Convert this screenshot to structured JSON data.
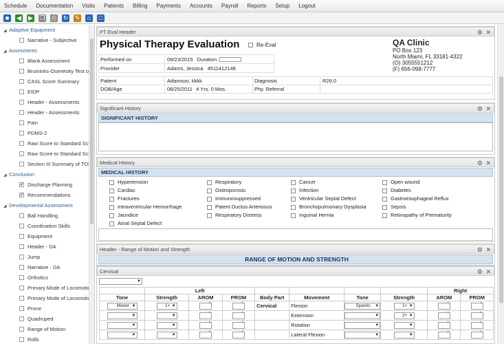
{
  "menu": [
    "Schedule",
    "Documentation",
    "Visits",
    "Patients",
    "Billing",
    "Payments",
    "Accounts",
    "Payroll",
    "Reports",
    "Setup",
    "Logout"
  ],
  "toolbar_icons": [
    "save-icon",
    "back-arrow-icon",
    "forward-arrow-icon",
    "copy-icon",
    "print-icon",
    "refresh-icon",
    "edit-icon",
    "home-icon",
    "export-icon"
  ],
  "sidebar": {
    "groups": [
      {
        "label": "Adaptive Equipment",
        "items": [
          {
            "label": "Narrative - Subjective",
            "checked": false
          }
        ]
      },
      {
        "label": "Assesments",
        "items": [
          {
            "label": "Blank Assessment",
            "checked": false
          },
          {
            "label": "Bruininks-Oseretsky Test of",
            "checked": false
          },
          {
            "label": "CASL Score Summary",
            "checked": false
          },
          {
            "label": "EIDP",
            "checked": false
          },
          {
            "label": "Header - Assessments",
            "checked": false
          },
          {
            "label": "Header - Assessments",
            "checked": false
          },
          {
            "label": "Pain",
            "checked": false
          },
          {
            "label": "PDMS-2",
            "checked": false
          },
          {
            "label": "Raw Score to Standard Sco",
            "checked": false
          },
          {
            "label": "Raw Score to Standard Sco",
            "checked": false
          },
          {
            "label": "Section III Summary of TOP",
            "checked": false
          }
        ]
      },
      {
        "label": "Conclusion",
        "items": [
          {
            "label": "Discharge Planning",
            "checked": true
          },
          {
            "label": "Recommendations",
            "checked": true
          }
        ]
      },
      {
        "label": "Developmental Assessment",
        "items": [
          {
            "label": "Ball Handling",
            "checked": false
          },
          {
            "label": "Coordination Skills",
            "checked": false
          },
          {
            "label": "Equipment",
            "checked": false
          },
          {
            "label": "Header - DA",
            "checked": false
          },
          {
            "label": "Jump",
            "checked": false
          },
          {
            "label": "Narrative - DA",
            "checked": false
          },
          {
            "label": "Orthotics",
            "checked": false
          },
          {
            "label": "Primary Mode of Locomotio",
            "checked": false
          },
          {
            "label": "Primary Mode of Locomotio",
            "checked": false
          },
          {
            "label": "Prone",
            "checked": false
          },
          {
            "label": "Quadruped",
            "checked": false
          },
          {
            "label": "Range of Motion",
            "checked": false
          },
          {
            "label": "Rolls",
            "checked": false
          }
        ]
      }
    ]
  },
  "eval_header": {
    "panel_title": "PT Eval Header",
    "title": "Physical Therapy Evaluation",
    "reeval_label": "Re-Eval",
    "performed_on_label": "Performed on",
    "performed_on": "09/23/2015",
    "duration_label": "Duration:",
    "provider_label": "Provider",
    "provider": "Adams, Jessica",
    "provider_id": "4511412148",
    "patient_label": "Patient",
    "patient": "Adamsoo, kkkk",
    "dob_label": "DOB/Age",
    "dob": "08/25/2011",
    "age": "4 Yrs. 0 Mos.",
    "diagnosis_label": "Diagnosis",
    "diagnosis": "R26.0",
    "referral_label": "Phy. Referral",
    "clinic": {
      "name": "QA Clinic",
      "address1": "PO Box 123",
      "address2": "North Miami, FL 33181-4322",
      "phone": "(O) 3055551212",
      "fax": "(F) 656-098-7777"
    }
  },
  "significant_history": {
    "panel_title": "Significant History",
    "heading": "SIGNIFICANT HISTORY"
  },
  "medical_history": {
    "panel_title": "Medical History",
    "heading": "MEDICAL HISTORY",
    "columns": [
      [
        "Hypertension",
        "Cardiac",
        "Fractures",
        "Intraventricular Hemorrhage",
        "Jaundice",
        "Atrial Septal Defect"
      ],
      [
        "Respiratory",
        "Osteoporosis",
        "Immunosuppressed",
        "Patent Ductus Arteriosus",
        "Respiratory Distress"
      ],
      [
        "Cancer",
        "Infection",
        "Ventricular Septal Defect",
        "Bronchopulmonary Dysplasia",
        "Inguinal Hernia"
      ],
      [
        "Open wound",
        "Diabetes",
        "Gastroesophageal Reflux",
        "Sepsis",
        "Retinopathy of Prematurity"
      ]
    ]
  },
  "rom": {
    "panel_title": "Header - Range of Motion and Strength",
    "heading": "RANGE OF MOTION AND STRENGTH",
    "sub_panel": "Cervical",
    "left_label": "Left",
    "right_label": "Right",
    "col_tone": "Tone",
    "col_strength": "Strength",
    "col_arom": "AROM",
    "col_prom": "PROM",
    "col_body_part": "Body Part",
    "col_movement": "Movement",
    "body_part": "Cervical",
    "degree_symbol": "°",
    "rows": [
      {
        "movement": "Flexion",
        "left_tone": "Mixed",
        "left_strength": "1+",
        "right_tone": "Spastic",
        "right_strength": "1+"
      },
      {
        "movement": "Extension",
        "left_tone": "",
        "left_strength": "",
        "right_tone": "",
        "right_strength": "2+"
      },
      {
        "movement": "Rotation",
        "left_tone": "",
        "left_strength": "",
        "right_tone": "",
        "right_strength": ""
      },
      {
        "movement": "Lateral Flexion",
        "left_tone": "",
        "left_strength": "",
        "right_tone": "",
        "right_strength": ""
      }
    ]
  }
}
